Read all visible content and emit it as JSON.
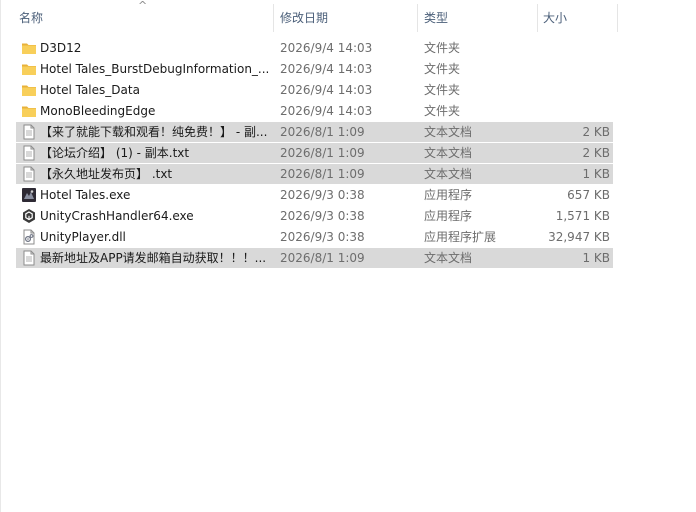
{
  "columns": {
    "name": "名称",
    "date": "修改日期",
    "type": "类型",
    "size": "大小"
  },
  "files": [
    {
      "name": "D3D12",
      "date": "2026/9/4 14:03",
      "type": "文件夹",
      "size": "",
      "icon": "folder-icon",
      "selected": false
    },
    {
      "name": "Hotel Tales_BurstDebugInformation_...",
      "date": "2026/9/4 14:03",
      "type": "文件夹",
      "size": "",
      "icon": "folder-icon",
      "selected": false
    },
    {
      "name": "Hotel Tales_Data",
      "date": "2026/9/4 14:03",
      "type": "文件夹",
      "size": "",
      "icon": "folder-icon",
      "selected": false
    },
    {
      "name": "MonoBleedingEdge",
      "date": "2026/9/4 14:03",
      "type": "文件夹",
      "size": "",
      "icon": "folder-icon",
      "selected": false
    },
    {
      "name": "【来了就能下载和观看！纯免费！】 - 副...",
      "date": "2026/8/1 1:09",
      "type": "文本文档",
      "size": "2 KB",
      "icon": "text-document-icon",
      "selected": true
    },
    {
      "name": "【论坛介绍】 (1) - 副本.txt",
      "date": "2026/8/1 1:09",
      "type": "文本文档",
      "size": "2 KB",
      "icon": "text-document-icon",
      "selected": true
    },
    {
      "name": "【永久地址发布页】 .txt",
      "date": "2026/8/1 1:09",
      "type": "文本文档",
      "size": "1 KB",
      "icon": "text-document-icon",
      "selected": true
    },
    {
      "name": "Hotel Tales.exe",
      "date": "2026/9/3 0:38",
      "type": "应用程序",
      "size": "657 KB",
      "icon": "app-exe-icon",
      "selected": false
    },
    {
      "name": "UnityCrashHandler64.exe",
      "date": "2026/9/3 0:38",
      "type": "应用程序",
      "size": "1,571 KB",
      "icon": "unity-icon",
      "selected": false
    },
    {
      "name": "UnityPlayer.dll",
      "date": "2026/9/3 0:38",
      "type": "应用程序扩展",
      "size": "32,947 KB",
      "icon": "dll-file-icon",
      "selected": false
    },
    {
      "name": "最新地址及APP请发邮箱自动获取！！！...",
      "date": "2026/8/1 1:09",
      "type": "文本文档",
      "size": "1 KB",
      "icon": "text-document-icon",
      "selected": true
    }
  ],
  "colors": {
    "header_text": "#4c607a",
    "selection": "#d9d9d9",
    "folder": "#f4c74a"
  }
}
